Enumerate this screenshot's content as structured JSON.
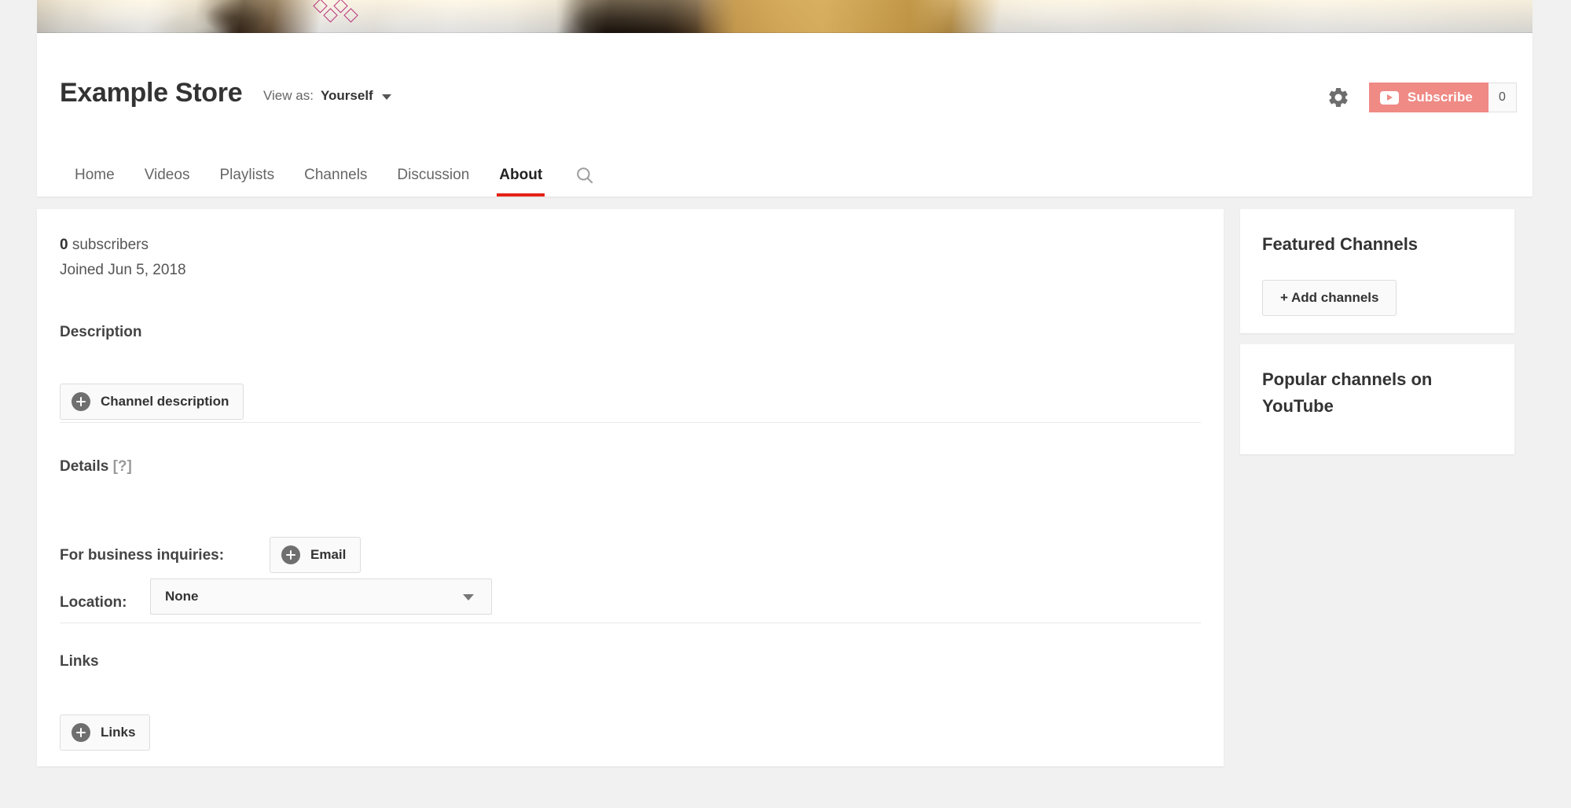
{
  "banner": {
    "alt": "channel-banner-photo"
  },
  "header": {
    "channel_title": "Example Store",
    "view_as_label": "View as:",
    "view_as_value": "Yourself",
    "gear_icon": "gear-icon",
    "subscribe_label": "Subscribe",
    "subscriber_count": "0",
    "subscribe_color": "#ef8a85"
  },
  "tabs": [
    {
      "label": "Home",
      "active": false
    },
    {
      "label": "Videos",
      "active": false
    },
    {
      "label": "Playlists",
      "active": false
    },
    {
      "label": "Channels",
      "active": false
    },
    {
      "label": "Discussion",
      "active": false
    },
    {
      "label": "About",
      "active": true
    }
  ],
  "tab_search_icon": "search-icon",
  "active_tab_underline_color": "#e62117",
  "main": {
    "subscribers_count": "0",
    "subscribers_word": " subscribers",
    "joined_text": "Joined Jun 5, 2018",
    "description_heading": "Description",
    "channel_description_button": "Channel description",
    "details_heading": "Details ",
    "details_help": "[?]",
    "business_label": "For business inquiries:",
    "email_button": "Email",
    "location_label": "Location:",
    "location_value": "None",
    "links_heading": "Links",
    "links_button": "Links"
  },
  "sidebar": {
    "featured_title": "Featured Channels",
    "add_channels_button": "+ Add channels",
    "popular_title": "Popular channels on YouTube"
  }
}
